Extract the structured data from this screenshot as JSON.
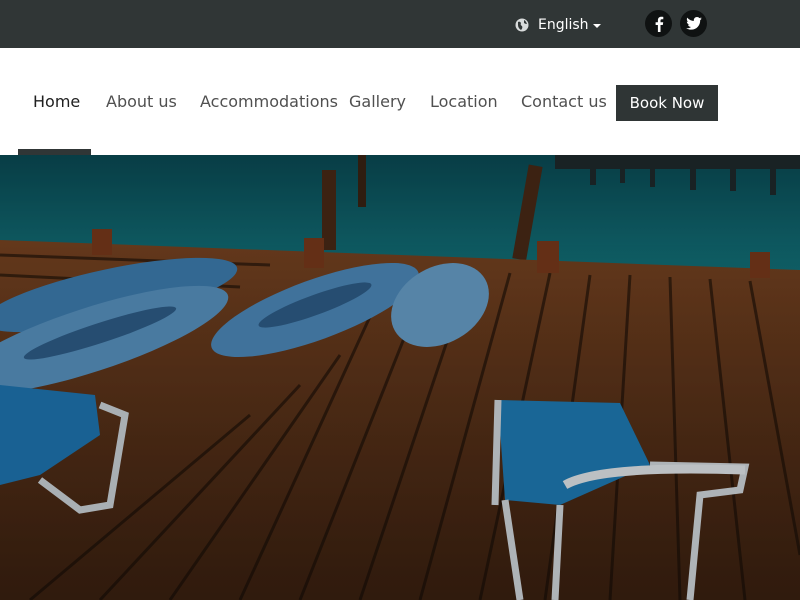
{
  "topbar": {
    "language": {
      "label": "English",
      "icon": "globe-icon"
    },
    "social": [
      {
        "name": "facebook",
        "icon": "facebook-icon",
        "glyph": "f"
      },
      {
        "name": "twitter",
        "icon": "twitter-icon"
      }
    ]
  },
  "nav": {
    "items": [
      {
        "label": "Home",
        "active": true
      },
      {
        "label": "About us"
      },
      {
        "label": "Accommodations"
      },
      {
        "label": "Gallery"
      },
      {
        "label": "Location"
      },
      {
        "label": "Contact us"
      }
    ],
    "cta": "Book Now"
  },
  "hero": {
    "scene": "wooden-dock-with-kayaks-and-loungers"
  },
  "colors": {
    "topbar": "#303636",
    "nav_bg": "#ffffff",
    "cta_bg": "#2f3535",
    "water": "#0e5a63",
    "wood": "#6a3c1f",
    "kayak": "#3f7fb2",
    "lounger": "#1f77b4"
  }
}
